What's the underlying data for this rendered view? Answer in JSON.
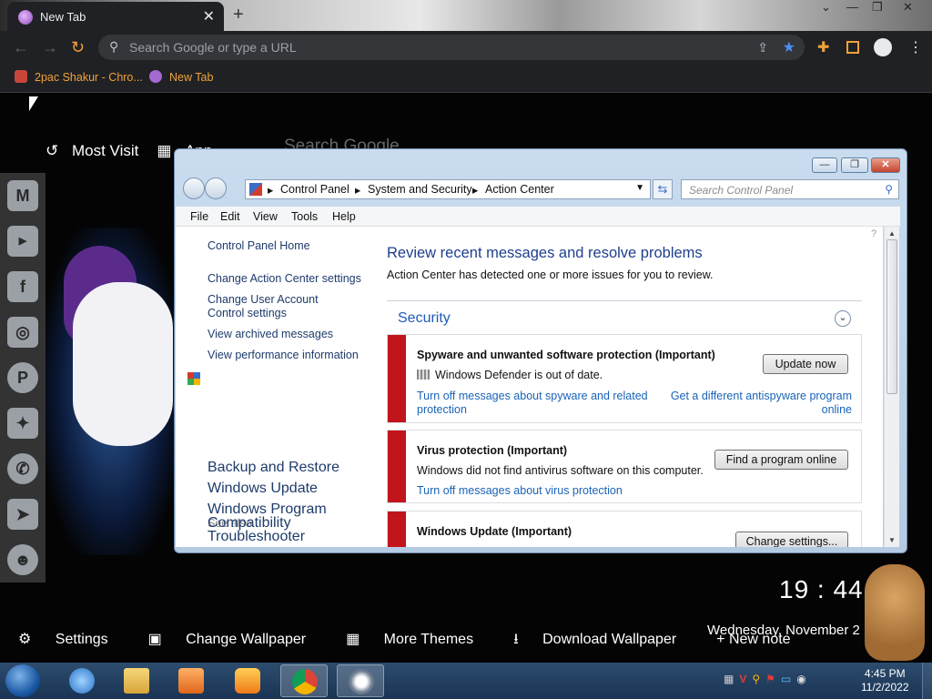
{
  "browser": {
    "tab_title": "New Tab",
    "close_glyph": "✕",
    "new_tab_glyph": "+",
    "minimize_glyph": "—",
    "maximize_glyph": "❐",
    "close_window_glyph": "✕",
    "dropdown_glyph": "⌄",
    "omnibox_placeholder": "Search Google or type a URL",
    "bookmarks": [
      "2pac Shakur - Chro...",
      "New Tab"
    ]
  },
  "ntp": {
    "top_links": [
      "Most Visit",
      "App"
    ],
    "search_google": "Search Google",
    "social_icons": [
      "gmail-icon",
      "youtube-icon",
      "facebook-icon",
      "instagram-icon",
      "pinterest-icon",
      "twitter-icon",
      "whatsapp-icon",
      "telegram-icon",
      "reddit-icon"
    ],
    "time": "19 : 44",
    "date": "Wednesday, November 2",
    "bottom": {
      "settings": "Settings",
      "change_wallpaper": "Change Wallpaper",
      "more_themes": "More Themes",
      "download_wallpaper": "Download Wallpaper",
      "new_note": "+ New note"
    }
  },
  "window": {
    "breadcrumb": [
      "Control Panel",
      "System and Security",
      "Action Center"
    ],
    "search_placeholder": "Search Control Panel",
    "menu": [
      "File",
      "Edit",
      "View",
      "Tools",
      "Help"
    ],
    "left": {
      "home": "Control Panel Home",
      "change_ac": "Change Action Center settings",
      "change_uac": "Change User Account Control settings",
      "archived": "View archived messages",
      "perf": "View performance information",
      "see_also": "See also",
      "backup": "Backup and Restore",
      "winupdate": "Windows Update",
      "compat": "Windows Program Compatibility Troubleshooter"
    },
    "main": {
      "heading": "Review recent messages and resolve problems",
      "subheading": "Action Center has detected one or more issues for you to review.",
      "section": "Security",
      "cards": [
        {
          "title": "Spyware and unwanted software protection  (Important)",
          "desc": "Windows Defender is out of date.",
          "link1": "Turn off messages about spyware and related protection",
          "link2": "Get a different antispyware program online",
          "button": "Update now"
        },
        {
          "title": "Virus protection  (Important)",
          "desc": "Windows did not find antivirus software on this computer.",
          "link1": "Turn off messages about virus protection",
          "button": "Find a program online"
        },
        {
          "title": "Windows Update  (Important)",
          "button": "Change settings..."
        }
      ]
    }
  },
  "taskbar": {
    "time": "4:45 PM",
    "date": "11/2/2022",
    "apps": [
      "internet-explorer-icon",
      "file-explorer-icon",
      "media-player-icon",
      "uc-browser-icon",
      "chrome-icon",
      "control-panel-icon"
    ]
  }
}
